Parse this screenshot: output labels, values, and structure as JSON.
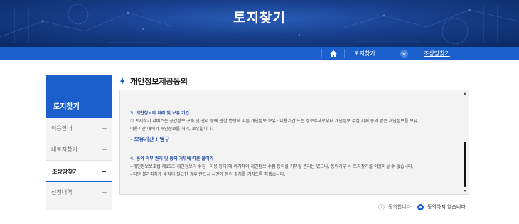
{
  "banner": {
    "title": "토지찾기"
  },
  "nav": {
    "home_icon": "home-icon",
    "item1": "토지찾기",
    "item2": "조상땅찾기",
    "colors": {
      "bar": "#1a5fcc",
      "banner": "#163f8c"
    }
  },
  "sidebar": {
    "title": "토지찾기",
    "items": [
      {
        "label": "이용안내",
        "active": false
      },
      {
        "label": "내토지찾기",
        "active": false
      },
      {
        "label": "조상땅찾기",
        "active": true
      },
      {
        "label": "신청내역",
        "active": false
      }
    ]
  },
  "section": {
    "icon": "lightning-bolt-icon",
    "title": "개인정보제공동의"
  },
  "terms": {
    "s3_heading": "3. 개인정보의 처리 및 보유 기간",
    "s3_line1": "① 토지찾기 서비스는 공간정보 구축 및 관리 등에 관한 법령에 따른 개인정보 보유ㆍ이용기간 또는 정보주체로부터 개인정보 수집 시에 동의 받은 개인정보를 보유,",
    "s3_line2": "이용기간 내에서 개인정보를 처리, 보유합니다.",
    "s3_period": "- 보유기간 : 영구",
    "s4_heading": "4. 동의 거부 권리 및 동의 거부에 따른 불이익",
    "s4_line1": "- 개인정보보호법 제15조(개인정보의 수집ㆍ이용 동의)에 의거하여 개인정보 수집 동의를 거부할 권리는 있으나, 동의거부 시 토지찾기를 이용하실 수 없습니다.",
    "s4_line2": "- 다만 불가피하게 수집이 필요한 경우 반드시 사전에 동의 절차를 거치도록 하겠습니다."
  },
  "consent": {
    "agree": {
      "label": "동의합니다",
      "selected": false
    },
    "disagree": {
      "label": "동의하지 않습니다",
      "selected": true
    }
  }
}
